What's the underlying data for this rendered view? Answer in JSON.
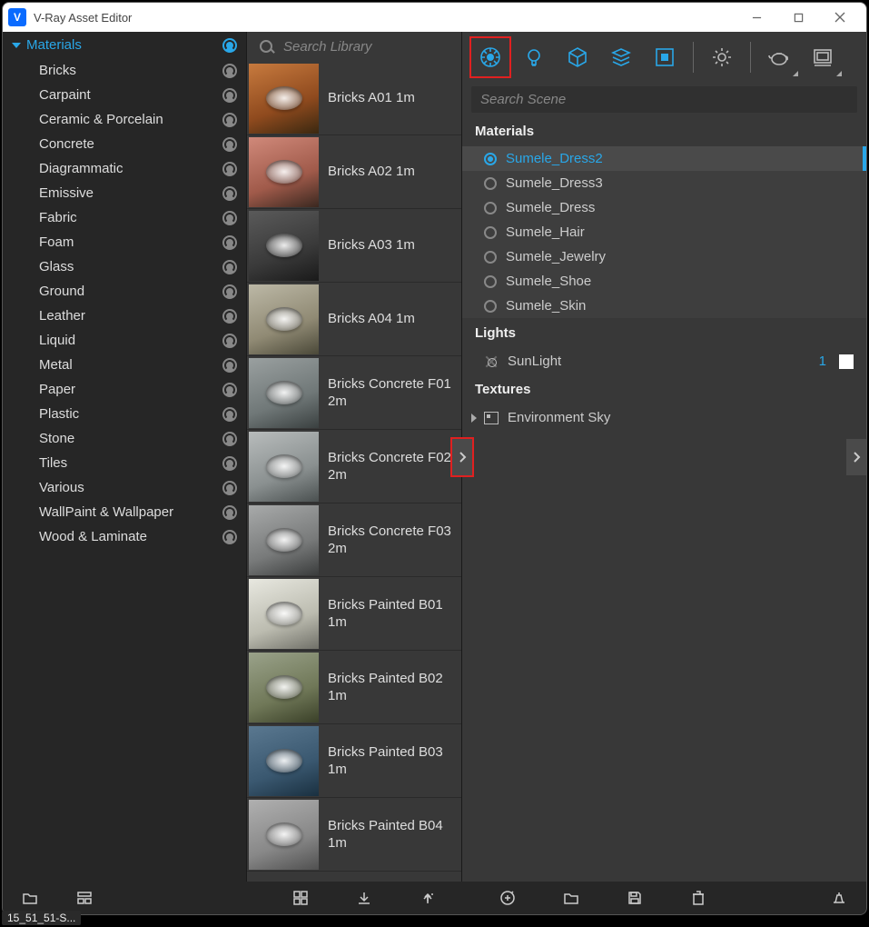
{
  "window": {
    "title": "V-Ray Asset Editor"
  },
  "sidebar": {
    "header": "Materials",
    "categories": [
      "Bricks",
      "Carpaint",
      "Ceramic & Porcelain",
      "Concrete",
      "Diagrammatic",
      "Emissive",
      "Fabric",
      "Foam",
      "Glass",
      "Ground",
      "Leather",
      "Liquid",
      "Metal",
      "Paper",
      "Plastic",
      "Stone",
      "Tiles",
      "Various",
      "WallPaint & Wallpaper",
      "Wood & Laminate"
    ]
  },
  "library": {
    "search_placeholder": "Search Library",
    "items": [
      {
        "label": "Bricks A01 1m",
        "thumbClass": "br1"
      },
      {
        "label": "Bricks A02 1m",
        "thumbClass": "br2"
      },
      {
        "label": "Bricks A03 1m",
        "thumbClass": "br3"
      },
      {
        "label": "Bricks A04 1m",
        "thumbClass": "br4"
      },
      {
        "label": "Bricks Concrete F01 2m",
        "thumbClass": "br5"
      },
      {
        "label": "Bricks Concrete F02 2m",
        "thumbClass": "br6"
      },
      {
        "label": "Bricks Concrete F03 2m",
        "thumbClass": "br7"
      },
      {
        "label": "Bricks Painted B01 1m",
        "thumbClass": "br8"
      },
      {
        "label": "Bricks Painted B02 1m",
        "thumbClass": "br9"
      },
      {
        "label": "Bricks Painted B03 1m",
        "thumbClass": "br10"
      },
      {
        "label": "Bricks Painted B04 1m",
        "thumbClass": "br11"
      }
    ]
  },
  "scene": {
    "search_placeholder": "Search Scene",
    "section_materials": "Materials",
    "materials": [
      {
        "label": "Sumele_Dress2",
        "selected": true
      },
      {
        "label": "Sumele_Dress3",
        "selected": false
      },
      {
        "label": "Sumele_Dress",
        "selected": false
      },
      {
        "label": "Sumele_Hair",
        "selected": false
      },
      {
        "label": "Sumele_Jewelry",
        "selected": false
      },
      {
        "label": "Sumele_Shoe",
        "selected": false
      },
      {
        "label": "Sumele_Skin",
        "selected": false
      }
    ],
    "section_lights": "Lights",
    "lights": [
      {
        "label": "SunLight",
        "count": "1",
        "swatch": "#ffffff"
      }
    ],
    "section_textures": "Textures",
    "textures": [
      {
        "label": "Environment Sky"
      }
    ]
  },
  "taskbar": "15_51_51-S..."
}
